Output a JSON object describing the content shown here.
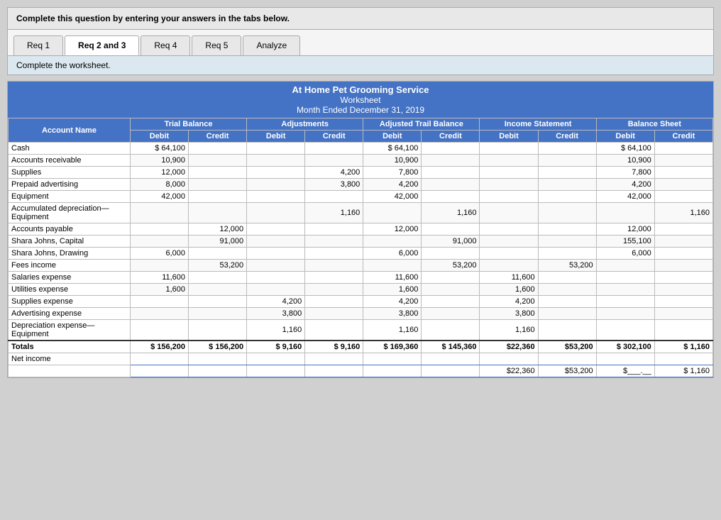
{
  "instruction": "Complete this question by entering your answers in the tabs below.",
  "tabs": [
    {
      "label": "Req 1",
      "active": false
    },
    {
      "label": "Req 2 and 3",
      "active": true
    },
    {
      "label": "Req 4",
      "active": false
    },
    {
      "label": "Req 5",
      "active": false
    },
    {
      "label": "Analyze",
      "active": false
    }
  ],
  "sub_instruction": "Complete the worksheet.",
  "worksheet": {
    "company": "At Home Pet Grooming Service",
    "doc_type": "Worksheet",
    "period": "Month Ended December 31, 2019",
    "columns": {
      "account": "Account Name",
      "trial_debit": "Debit",
      "trial_credit": "Credit",
      "adj_debit": "Debit",
      "adj_credit": "Credit",
      "atb_debit": "Debit",
      "atb_credit": "Credit",
      "is_debit": "Debit",
      "is_credit": "Credit",
      "bs_debit": "Debit",
      "bs_credit": "Credit"
    },
    "section_headers": {
      "trial_balance": "Trial Balance",
      "adjustments": "Adjustments",
      "adjusted_trail": "Adjusted Trail Balance",
      "income_statement": "Income Statement",
      "balance_sheet": "Balance Sheet"
    },
    "rows": [
      {
        "account": "Cash",
        "tb_d": "$ 64,100",
        "tb_c": "",
        "adj_d": "",
        "adj_c": "",
        "atb_d": "$ 64,100",
        "atb_c": "",
        "is_d": "",
        "is_c": "",
        "bs_d": "$ 64,100",
        "bs_c": ""
      },
      {
        "account": "Accounts receivable",
        "tb_d": "10,900",
        "tb_c": "",
        "adj_d": "",
        "adj_c": "",
        "atb_d": "10,900",
        "atb_c": "",
        "is_d": "",
        "is_c": "",
        "bs_d": "10,900",
        "bs_c": ""
      },
      {
        "account": "Supplies",
        "tb_d": "12,000",
        "tb_c": "",
        "adj_d": "",
        "adj_c": "4,200",
        "atb_d": "7,800",
        "atb_c": "",
        "is_d": "",
        "is_c": "",
        "bs_d": "7,800",
        "bs_c": ""
      },
      {
        "account": "Prepaid advertising",
        "tb_d": "8,000",
        "tb_c": "",
        "adj_d": "",
        "adj_c": "3,800",
        "atb_d": "4,200",
        "atb_c": "",
        "is_d": "",
        "is_c": "",
        "bs_d": "4,200",
        "bs_c": ""
      },
      {
        "account": "Equipment",
        "tb_d": "42,000",
        "tb_c": "",
        "adj_d": "",
        "adj_c": "",
        "atb_d": "42,000",
        "atb_c": "",
        "is_d": "",
        "is_c": "",
        "bs_d": "42,000",
        "bs_c": ""
      },
      {
        "account": "Accumulated depreciation—\nEquipment",
        "tb_d": "",
        "tb_c": "",
        "adj_d": "",
        "adj_c": "1,160",
        "atb_d": "",
        "atb_c": "1,160",
        "is_d": "",
        "is_c": "",
        "bs_d": "",
        "bs_c": "1,160"
      },
      {
        "account": "Accounts payable",
        "tb_d": "",
        "tb_c": "12,000",
        "adj_d": "",
        "adj_c": "",
        "atb_d": "12,000",
        "atb_c": "",
        "is_d": "",
        "is_c": "",
        "bs_d": "12,000",
        "bs_c": ""
      },
      {
        "account": "Shara Johns, Capital",
        "tb_d": "",
        "tb_c": "91,000",
        "adj_d": "",
        "adj_c": "",
        "atb_d": "",
        "atb_c": "91,000",
        "is_d": "",
        "is_c": "",
        "bs_d": "155,100",
        "bs_c": ""
      },
      {
        "account": "Shara Johns, Drawing",
        "tb_d": "6,000",
        "tb_c": "",
        "adj_d": "",
        "adj_c": "",
        "atb_d": "6,000",
        "atb_c": "",
        "is_d": "",
        "is_c": "",
        "bs_d": "6,000",
        "bs_c": ""
      },
      {
        "account": "Fees income",
        "tb_d": "",
        "tb_c": "53,200",
        "adj_d": "",
        "adj_c": "",
        "atb_d": "",
        "atb_c": "53,200",
        "is_d": "",
        "is_c": "53,200",
        "bs_d": "",
        "bs_c": ""
      },
      {
        "account": "Salaries expense",
        "tb_d": "11,600",
        "tb_c": "",
        "adj_d": "",
        "adj_c": "",
        "atb_d": "11,600",
        "atb_c": "",
        "is_d": "11,600",
        "is_c": "",
        "bs_d": "",
        "bs_c": ""
      },
      {
        "account": "Utilities expense",
        "tb_d": "1,600",
        "tb_c": "",
        "adj_d": "",
        "adj_c": "",
        "atb_d": "1,600",
        "atb_c": "",
        "is_d": "1,600",
        "is_c": "",
        "bs_d": "",
        "bs_c": ""
      },
      {
        "account": "Supplies expense",
        "tb_d": "",
        "tb_c": "",
        "adj_d": "4,200",
        "adj_c": "",
        "atb_d": "4,200",
        "atb_c": "",
        "is_d": "4,200",
        "is_c": "",
        "bs_d": "",
        "bs_c": ""
      },
      {
        "account": "Advertising expense",
        "tb_d": "",
        "tb_c": "",
        "adj_d": "3,800",
        "adj_c": "",
        "atb_d": "3,800",
        "atb_c": "",
        "is_d": "3,800",
        "is_c": "",
        "bs_d": "",
        "bs_c": ""
      },
      {
        "account": "Depreciation expense—\nEquipment",
        "tb_d": "",
        "tb_c": "",
        "adj_d": "1,160",
        "adj_c": "",
        "atb_d": "1,160",
        "atb_c": "",
        "is_d": "1,160",
        "is_c": "",
        "bs_d": "",
        "bs_c": ""
      },
      {
        "account": "Totals",
        "tb_d": "$ 156,200",
        "tb_c": "$ 156,200",
        "adj_d": "$ 9,160",
        "adj_c": "$ 9,160",
        "atb_d": "$ 169,360",
        "atb_c": "$ 145,360",
        "is_d": "$22,360",
        "is_c": "$53,200",
        "bs_d": "$ 302,100",
        "bs_c": "$ 1,160"
      },
      {
        "account": "Net income",
        "tb_d": "",
        "tb_c": "",
        "adj_d": "",
        "adj_c": "",
        "atb_d": "",
        "atb_c": "",
        "is_d": "",
        "is_c": "",
        "bs_d": "",
        "bs_c": ""
      },
      {
        "account": "",
        "tb_d": "",
        "tb_c": "",
        "adj_d": "",
        "adj_c": "",
        "atb_d": "",
        "atb_c": "",
        "is_d": "$22,360",
        "is_c": "$53,200",
        "bs_d": "$___.__",
        "bs_c": "$ 1,160"
      }
    ]
  }
}
